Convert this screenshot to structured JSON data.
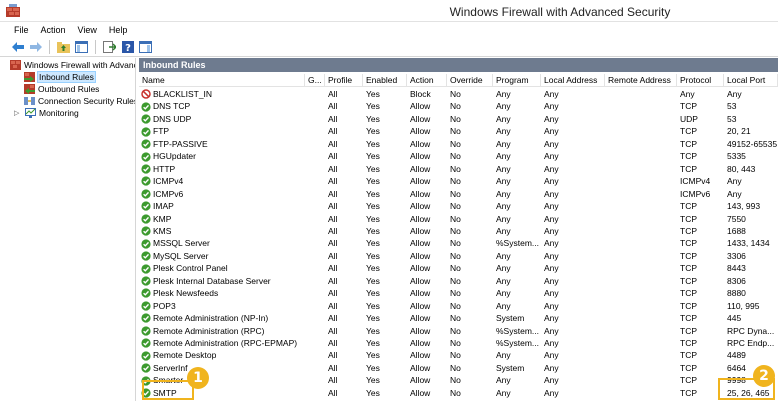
{
  "window": {
    "title": "Windows Firewall with Advanced Security"
  },
  "menu": [
    "File",
    "Action",
    "View",
    "Help"
  ],
  "tree": {
    "root": "Windows Firewall with Advance",
    "items": [
      "Inbound Rules",
      "Outbound Rules",
      "Connection Security Rules",
      "Monitoring"
    ],
    "selected": "Inbound Rules"
  },
  "panel": {
    "title": "Inbound Rules"
  },
  "columns": [
    "Name",
    "G...",
    "Profile",
    "Enabled",
    "Action",
    "Override",
    "Program",
    "Local Address",
    "Remote Address",
    "Protocol",
    "Local Port"
  ],
  "rules": [
    {
      "name": "BLACKLIST_IN",
      "icon": "block-icon",
      "profile": "All",
      "enabled": "Yes",
      "action": "Block",
      "override": "No",
      "program": "Any",
      "local": "Any",
      "remote": "",
      "protocol": "Any",
      "port": "Any"
    },
    {
      "name": "DNS TCP",
      "icon": "allow-icon",
      "profile": "All",
      "enabled": "Yes",
      "action": "Allow",
      "override": "No",
      "program": "Any",
      "local": "Any",
      "remote": "",
      "protocol": "TCP",
      "port": "53"
    },
    {
      "name": "DNS UDP",
      "icon": "allow-icon",
      "profile": "All",
      "enabled": "Yes",
      "action": "Allow",
      "override": "No",
      "program": "Any",
      "local": "Any",
      "remote": "",
      "protocol": "UDP",
      "port": "53"
    },
    {
      "name": "FTP",
      "icon": "allow-icon",
      "profile": "All",
      "enabled": "Yes",
      "action": "Allow",
      "override": "No",
      "program": "Any",
      "local": "Any",
      "remote": "",
      "protocol": "TCP",
      "port": "20, 21"
    },
    {
      "name": "FTP-PASSIVE",
      "icon": "allow-icon",
      "profile": "All",
      "enabled": "Yes",
      "action": "Allow",
      "override": "No",
      "program": "Any",
      "local": "Any",
      "remote": "",
      "protocol": "TCP",
      "port": "49152-65535"
    },
    {
      "name": "HGUpdater",
      "icon": "allow-icon",
      "profile": "All",
      "enabled": "Yes",
      "action": "Allow",
      "override": "No",
      "program": "Any",
      "local": "Any",
      "remote": "",
      "protocol": "TCP",
      "port": "5335"
    },
    {
      "name": "HTTP",
      "icon": "allow-icon",
      "profile": "All",
      "enabled": "Yes",
      "action": "Allow",
      "override": "No",
      "program": "Any",
      "local": "Any",
      "remote": "",
      "protocol": "TCP",
      "port": "80, 443"
    },
    {
      "name": "ICMPv4",
      "icon": "allow-icon",
      "profile": "All",
      "enabled": "Yes",
      "action": "Allow",
      "override": "No",
      "program": "Any",
      "local": "Any",
      "remote": "",
      "protocol": "ICMPv4",
      "port": "Any"
    },
    {
      "name": "ICMPv6",
      "icon": "allow-icon",
      "profile": "All",
      "enabled": "Yes",
      "action": "Allow",
      "override": "No",
      "program": "Any",
      "local": "Any",
      "remote": "",
      "protocol": "ICMPv6",
      "port": "Any"
    },
    {
      "name": "IMAP",
      "icon": "allow-icon",
      "profile": "All",
      "enabled": "Yes",
      "action": "Allow",
      "override": "No",
      "program": "Any",
      "local": "Any",
      "remote": "",
      "protocol": "TCP",
      "port": "143, 993"
    },
    {
      "name": "KMP",
      "icon": "allow-icon",
      "profile": "All",
      "enabled": "Yes",
      "action": "Allow",
      "override": "No",
      "program": "Any",
      "local": "Any",
      "remote": "",
      "protocol": "TCP",
      "port": "7550"
    },
    {
      "name": "KMS",
      "icon": "allow-icon",
      "profile": "All",
      "enabled": "Yes",
      "action": "Allow",
      "override": "No",
      "program": "Any",
      "local": "Any",
      "remote": "",
      "protocol": "TCP",
      "port": "1688"
    },
    {
      "name": "MSSQL Server",
      "icon": "allow-icon",
      "profile": "All",
      "enabled": "Yes",
      "action": "Allow",
      "override": "No",
      "program": "%System...",
      "local": "Any",
      "remote": "",
      "protocol": "TCP",
      "port": "1433, 1434"
    },
    {
      "name": "MySQL Server",
      "icon": "allow-icon",
      "profile": "All",
      "enabled": "Yes",
      "action": "Allow",
      "override": "No",
      "program": "Any",
      "local": "Any",
      "remote": "",
      "protocol": "TCP",
      "port": "3306"
    },
    {
      "name": "Plesk Control Panel",
      "icon": "allow-icon",
      "profile": "All",
      "enabled": "Yes",
      "action": "Allow",
      "override": "No",
      "program": "Any",
      "local": "Any",
      "remote": "",
      "protocol": "TCP",
      "port": "8443"
    },
    {
      "name": "Plesk Internal Database Server",
      "icon": "allow-icon",
      "profile": "All",
      "enabled": "Yes",
      "action": "Allow",
      "override": "No",
      "program": "Any",
      "local": "Any",
      "remote": "",
      "protocol": "TCP",
      "port": "8306"
    },
    {
      "name": "Plesk Newsfeeds",
      "icon": "allow-icon",
      "profile": "All",
      "enabled": "Yes",
      "action": "Allow",
      "override": "No",
      "program": "Any",
      "local": "Any",
      "remote": "",
      "protocol": "TCP",
      "port": "8880"
    },
    {
      "name": "POP3",
      "icon": "allow-icon",
      "profile": "All",
      "enabled": "Yes",
      "action": "Allow",
      "override": "No",
      "program": "Any",
      "local": "Any",
      "remote": "",
      "protocol": "TCP",
      "port": "110, 995"
    },
    {
      "name": "Remote Administration (NP-In)",
      "icon": "allow-icon",
      "profile": "All",
      "enabled": "Yes",
      "action": "Allow",
      "override": "No",
      "program": "System",
      "local": "Any",
      "remote": "",
      "protocol": "TCP",
      "port": "445"
    },
    {
      "name": "Remote Administration (RPC)",
      "icon": "allow-icon",
      "profile": "All",
      "enabled": "Yes",
      "action": "Allow",
      "override": "No",
      "program": "%System...",
      "local": "Any",
      "remote": "",
      "protocol": "TCP",
      "port": "RPC Dyna..."
    },
    {
      "name": "Remote Administration (RPC-EPMAP)",
      "icon": "allow-icon",
      "profile": "All",
      "enabled": "Yes",
      "action": "Allow",
      "override": "No",
      "program": "%System...",
      "local": "Any",
      "remote": "",
      "protocol": "TCP",
      "port": "RPC Endp..."
    },
    {
      "name": "Remote Desktop",
      "icon": "allow-icon",
      "profile": "All",
      "enabled": "Yes",
      "action": "Allow",
      "override": "No",
      "program": "Any",
      "local": "Any",
      "remote": "",
      "protocol": "TCP",
      "port": "4489"
    },
    {
      "name": "ServerInf",
      "icon": "allow-icon",
      "profile": "All",
      "enabled": "Yes",
      "action": "Allow",
      "override": "No",
      "program": "System",
      "local": "Any",
      "remote": "",
      "protocol": "TCP",
      "port": "6464"
    },
    {
      "name": "Smarter",
      "icon": "allow-icon",
      "profile": "All",
      "enabled": "Yes",
      "action": "Allow",
      "override": "No",
      "program": "Any",
      "local": "Any",
      "remote": "",
      "protocol": "TCP",
      "port": "9998"
    },
    {
      "name": "SMTP",
      "icon": "allow-icon",
      "profile": "All",
      "enabled": "Yes",
      "action": "Allow",
      "override": "No",
      "program": "Any",
      "local": "Any",
      "remote": "",
      "protocol": "TCP",
      "port": "25, 26, 465"
    }
  ],
  "callouts": [
    {
      "label": "1",
      "color": "#f0b41e"
    },
    {
      "label": "2",
      "color": "#f0b41e"
    }
  ],
  "colors": {
    "header": "#6e7b8f",
    "accent": "#f0b41e",
    "allow": "#3c9a2e",
    "block": "#c8322d"
  }
}
